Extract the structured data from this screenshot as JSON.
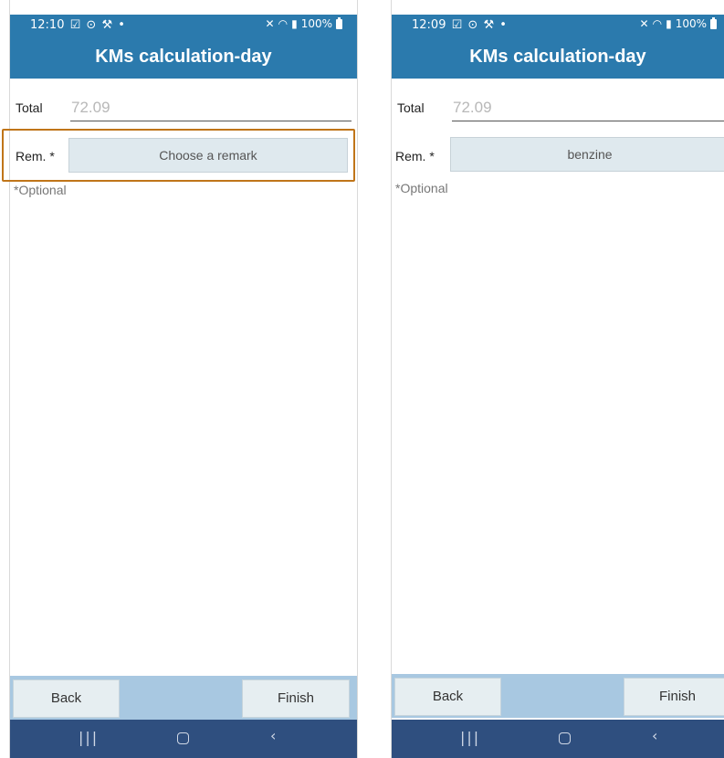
{
  "accent_color": "#2b7aad",
  "highlight_color": "#c07519",
  "screens": [
    {
      "status": {
        "time": "12:10",
        "signal": "100%"
      },
      "title": "KMs calculation-day",
      "total_label": "Total",
      "total_value": "72.09",
      "remark_label": "Rem. *",
      "remark_value": "Choose a remark",
      "optional_note": "*Optional",
      "back_label": "Back",
      "finish_label": "Finish"
    },
    {
      "status": {
        "time": "12:09",
        "signal": "100%"
      },
      "title": "KMs calculation-day",
      "total_label": "Total",
      "total_value": "72.09",
      "remark_label": "Rem. *",
      "remark_value": "benzine",
      "optional_note": "*Optional",
      "back_label": "Back",
      "finish_label": "Finish"
    }
  ],
  "icons": {
    "status_left": [
      "checkbox-icon",
      "location-icon",
      "wrench-icon",
      "dot-icon"
    ],
    "status_right": [
      "mute-icon",
      "wifi-icon",
      "signal-icon",
      "battery-icon"
    ],
    "nav": [
      "recents-icon",
      "home-icon",
      "back-icon"
    ]
  }
}
